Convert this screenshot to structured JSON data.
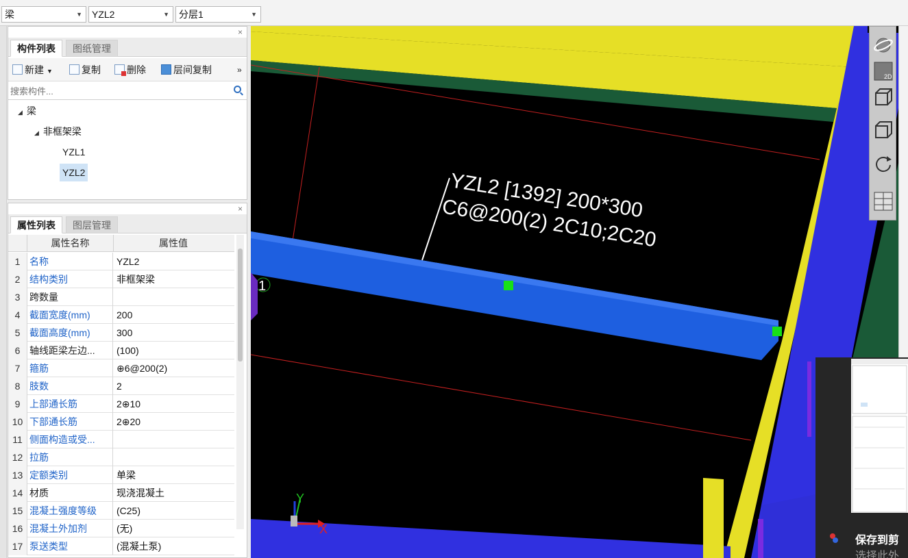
{
  "topbar": {
    "type_select": "梁",
    "component_select": "YZL2",
    "layer_select": "分层1"
  },
  "component_panel": {
    "tabs": [
      "构件列表",
      "图纸管理"
    ],
    "toolbar": {
      "new": "新建",
      "copy": "复制",
      "delete": "删除",
      "floor_copy": "层间复制",
      "more": "»"
    },
    "search_placeholder": "搜索构件...",
    "tree": {
      "root": "梁",
      "group": "非框架梁",
      "items": [
        "YZL1",
        "YZL2"
      ],
      "selected": "YZL2"
    }
  },
  "property_panel": {
    "tabs": [
      "属性列表",
      "图层管理"
    ],
    "columns": [
      "属性名称",
      "属性值"
    ],
    "rows": [
      {
        "num": "1",
        "name": "名称",
        "value": "YZL2",
        "blue": true
      },
      {
        "num": "2",
        "name": "结构类别",
        "value": "非框架梁",
        "blue": true
      },
      {
        "num": "3",
        "name": "跨数量",
        "value": "",
        "blue": false
      },
      {
        "num": "4",
        "name": "截面宽度(mm)",
        "value": "200",
        "blue": true
      },
      {
        "num": "5",
        "name": "截面高度(mm)",
        "value": "300",
        "blue": true
      },
      {
        "num": "6",
        "name": "轴线距梁左边...",
        "value": "(100)",
        "blue": false
      },
      {
        "num": "7",
        "name": "箍筋",
        "value": "⊕6@200(2)",
        "blue": true
      },
      {
        "num": "8",
        "name": "肢数",
        "value": "2",
        "blue": true
      },
      {
        "num": "9",
        "name": "上部通长筋",
        "value": "2⊕10",
        "blue": true
      },
      {
        "num": "10",
        "name": "下部通长筋",
        "value": "2⊕20",
        "blue": true
      },
      {
        "num": "11",
        "name": "侧面构造或受...",
        "value": "",
        "blue": true
      },
      {
        "num": "12",
        "name": "拉筋",
        "value": "",
        "blue": true
      },
      {
        "num": "13",
        "name": "定额类别",
        "value": "单梁",
        "blue": true
      },
      {
        "num": "14",
        "name": "材质",
        "value": "现浇混凝土",
        "blue": false
      },
      {
        "num": "15",
        "name": "混凝土强度等级",
        "value": "(C25)",
        "blue": true
      },
      {
        "num": "16",
        "name": "混凝土外加剂",
        "value": "(无)",
        "blue": true
      },
      {
        "num": "17",
        "name": "泵送类型",
        "value": "(混凝土泵)",
        "blue": true
      }
    ]
  },
  "viewport": {
    "beam_label_line1": "YZL2 [1392] 200*300",
    "beam_label_line2": "C6@200(2) 2C10;2C20",
    "axis_marker": "1",
    "axis_x": "X",
    "axis_y": "Y",
    "colors": {
      "beam": "#1e5fe0",
      "wall_yellow": "#e8e02a",
      "wall_blue": "#3232e0",
      "slab_green": "#1f5a3a",
      "grip": "#18e018"
    }
  },
  "view_tools": [
    "orbit-icon",
    "2d-view-icon",
    "3d-box-icon",
    "view-cube-icon",
    "rotate-icon",
    "grid-select-icon"
  ],
  "view_tool_label_2d": "2D",
  "clipboard_popup": {
    "title": "保存到剪",
    "subtitle": "选择此外"
  }
}
